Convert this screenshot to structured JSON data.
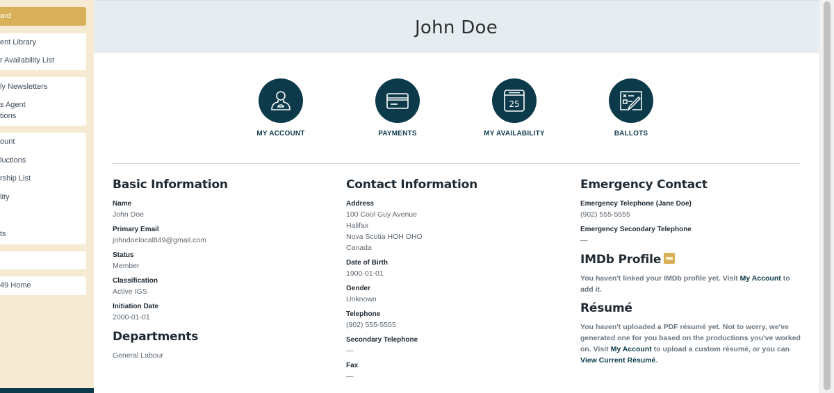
{
  "sidebar": {
    "active_item": "ard",
    "items": [
      "ent Library",
      "r Availability List",
      "ly Newsletters",
      "s Agent",
      "tions",
      "ount",
      "luctions",
      "rship List",
      "lity",
      "ts",
      "49 Home"
    ]
  },
  "header": {
    "title": "John Doe"
  },
  "quick_links": [
    {
      "label": "MY ACCOUNT",
      "icon": "user-icon"
    },
    {
      "label": "PAYMENTS",
      "icon": "credit-card-icon"
    },
    {
      "label": "MY AVAILABILITY",
      "icon": "calendar-icon",
      "calendar_day": "25"
    },
    {
      "label": "BALLOTS",
      "icon": "ballot-icon"
    }
  ],
  "basic_information": {
    "title": "Basic Information",
    "name_label": "Name",
    "name": "John Doe",
    "email_label": "Primary Email",
    "email": "johndoelocal849@gmail.com",
    "status_label": "Status",
    "status": "Member",
    "classification_label": "Classification",
    "classification": "Active IGS",
    "initiation_label": "Initiation Date",
    "initiation": "2000-01-01"
  },
  "departments": {
    "title": "Departments",
    "value": "General Labour"
  },
  "contact_information": {
    "title": "Contact Information",
    "address_label": "Address",
    "address_lines": [
      "100 Cool Guy Avenue",
      "Halifax",
      "Nova Scotia HOH OHO",
      "Canada"
    ],
    "dob_label": "Date of Birth",
    "dob": "1900-01-01",
    "gender_label": "Gender",
    "gender": "Unknown",
    "telephone_label": "Telephone",
    "telephone": "(902) 555-5555",
    "secondary_label": "Secondary Telephone",
    "secondary": "—",
    "fax_label": "Fax",
    "fax": "—"
  },
  "emergency_contact": {
    "title": "Emergency Contact",
    "telephone_label": "Emergency Telephone (Jane Doe)",
    "telephone": "(902) 555-5555",
    "secondary_label": "Emergency Secondary Telephone",
    "secondary": "—"
  },
  "imdb": {
    "title": "IMDb Profile",
    "note_before": "You haven't linked your IMDb profile yet. Visit ",
    "link": "My Account",
    "note_after": " to add it."
  },
  "resume": {
    "title": "Résumé",
    "note_1": "You haven't uploaded a PDF résumé yet. Not to worry, we've generated one for you based on the productions you've worked on. Visit ",
    "link_1": "My Account",
    "note_2": " to upload a custom résumé, or you can ",
    "link_2": "View Current Résumé",
    "note_3": "."
  },
  "colors": {
    "navy": "#0c3a4a",
    "gold": "#d9b05a",
    "sidebar_bg": "#f6ead3",
    "header_bg": "#e6ecef"
  }
}
